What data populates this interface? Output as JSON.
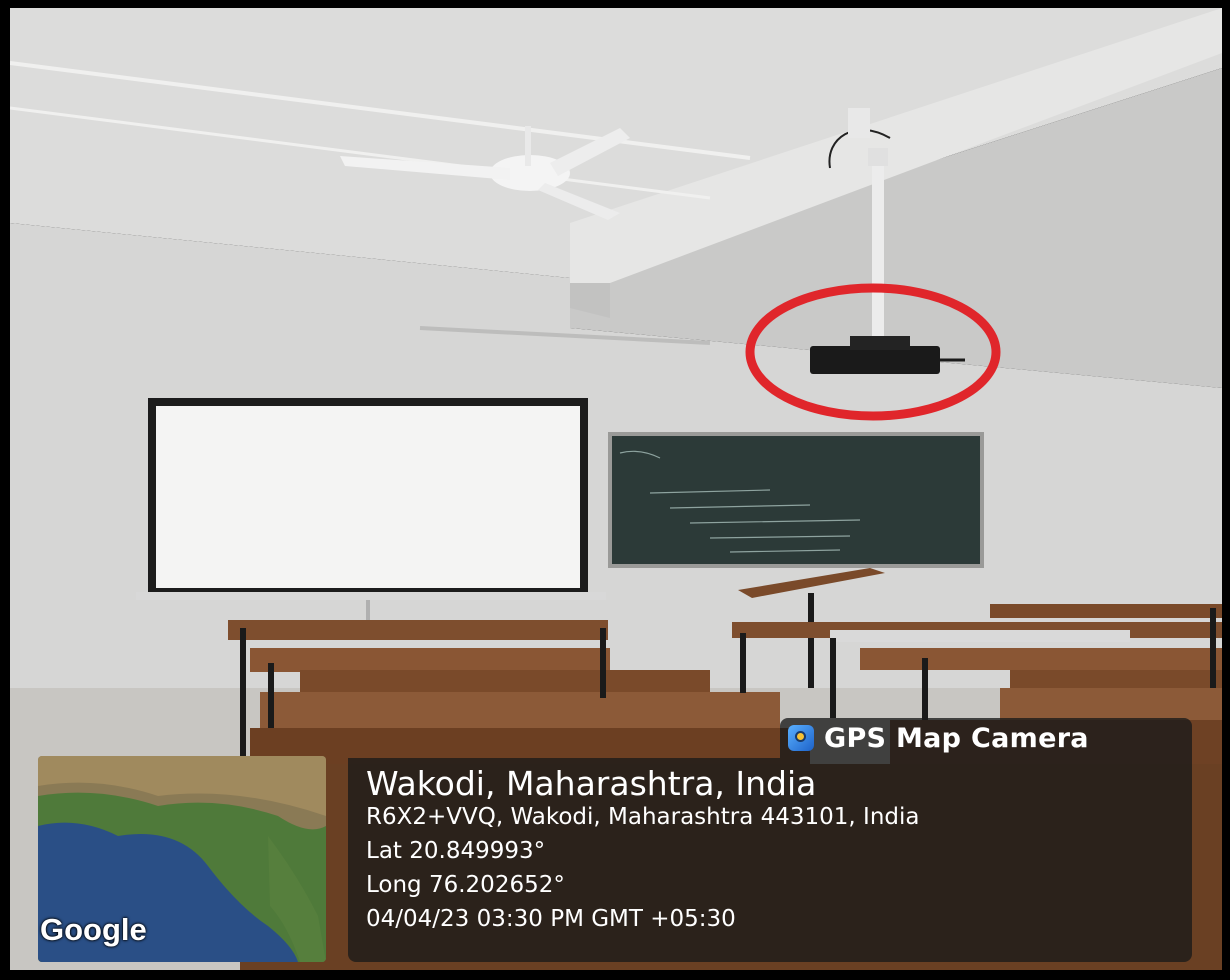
{
  "gps_overlay": {
    "app_name": "GPS Map Camera",
    "place": "Wakodi, Maharashtra, India",
    "address": "R6X2+VVQ, Wakodi, Maharashtra 443101, India",
    "latitude": "Lat 20.849993°",
    "longitude": "Long 76.202652°",
    "datetime": "04/04/23 03:30 PM GMT +05:30",
    "map_logo": "Google"
  },
  "annotation": {
    "highlight_color": "#e0262b",
    "icon": "red-circle-highlight"
  }
}
